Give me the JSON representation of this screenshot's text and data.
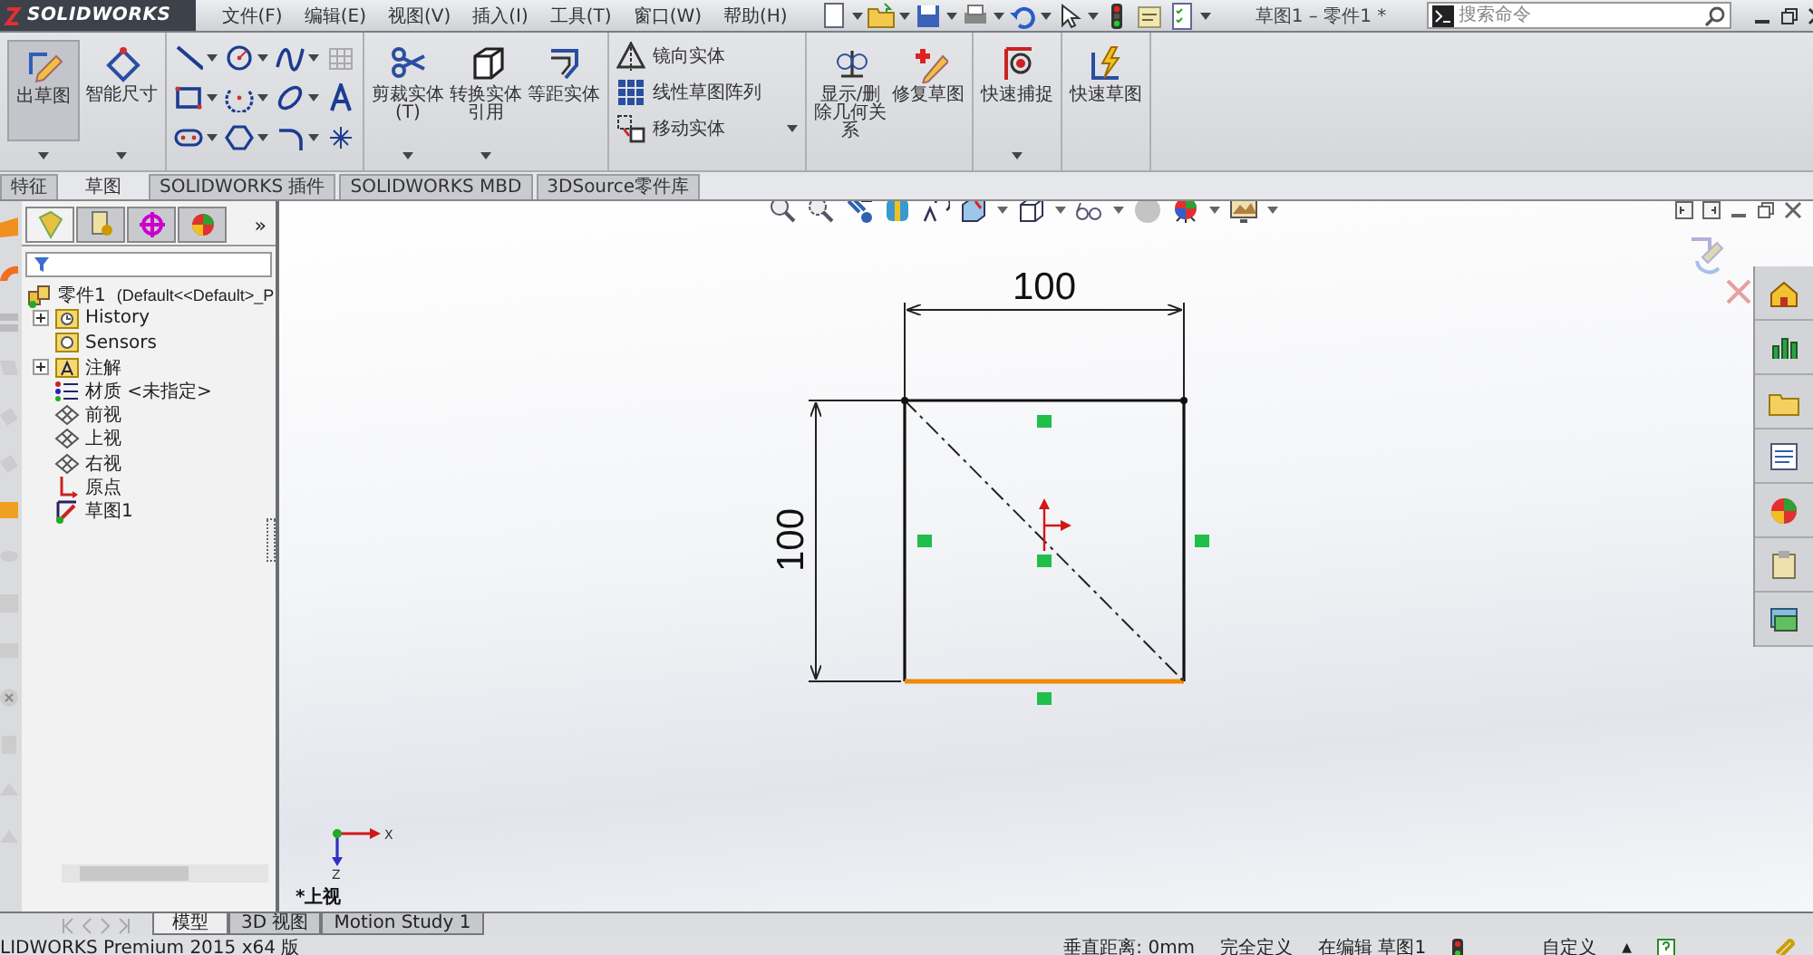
{
  "title_bar": {
    "logo": "SOLIDWORKS",
    "menus": [
      "文件(F)",
      "编辑(E)",
      "视图(V)",
      "插入(I)",
      "工具(T)",
      "窗口(W)",
      "帮助(H)"
    ],
    "document_title": "草图1 – 零件1 *",
    "search": {
      "placeholder": "搜索命令"
    }
  },
  "ribbon": {
    "groups": [
      {
        "kind": "large",
        "items": [
          {
            "label": "出草图",
            "pressed": true
          },
          {
            "label": "智能尺寸",
            "pressed": false
          }
        ]
      },
      {
        "kind": "tools"
      },
      {
        "kind": "large",
        "items": [
          {
            "label": "剪裁实体(T)",
            "pressed": false
          },
          {
            "label": "转换实体引用",
            "pressed": false
          },
          {
            "label": "等距实体",
            "pressed": false
          }
        ]
      },
      {
        "kind": "list",
        "items": [
          {
            "label": "镜向实体"
          },
          {
            "label": "线性草图阵列"
          },
          {
            "label": "移动实体"
          }
        ]
      },
      {
        "kind": "large",
        "items": [
          {
            "label": "显示/删除几何关系",
            "pressed": false
          },
          {
            "label": "修复草图",
            "pressed": false
          }
        ]
      },
      {
        "kind": "large",
        "items": [
          {
            "label": "快速捕捉",
            "pressed": false
          }
        ]
      },
      {
        "kind": "large",
        "items": [
          {
            "label": "快速草图",
            "pressed": false
          }
        ]
      }
    ]
  },
  "command_tabs": [
    {
      "label": "特征",
      "selected": false
    },
    {
      "label": "草图",
      "selected": true
    },
    {
      "label": "SOLIDWORKS 插件",
      "selected": false
    },
    {
      "label": "SOLIDWORKS MBD",
      "selected": false
    },
    {
      "label": "3DSource零件库",
      "selected": false
    }
  ],
  "feature_manager": {
    "tabs": [
      {
        "selected": true
      },
      {
        "selected": false
      },
      {
        "selected": false
      },
      {
        "selected": false
      }
    ],
    "more": "»",
    "root": {
      "label": "零件1",
      "config": "(Default<<Default>_P",
      "children": [
        {
          "label": "History",
          "expander": true
        },
        {
          "label": "Sensors",
          "expander": false
        },
        {
          "label": "注解",
          "expander": true
        },
        {
          "label": "材质 <未指定>",
          "expander": false
        },
        {
          "label": "前视",
          "expander": false
        },
        {
          "label": "上视",
          "expander": false
        },
        {
          "label": "右视",
          "expander": false
        },
        {
          "label": "原点",
          "expander": false
        },
        {
          "label": "草图1",
          "expander": false
        }
      ]
    }
  },
  "graphics_area": {
    "dimensions": {
      "horizontal": "100",
      "vertical": "100"
    },
    "triad": {
      "x_label": "X",
      "z_label": "Z"
    },
    "view_label": "*上视"
  },
  "bottom_tabs": [
    {
      "label": "模型",
      "selected": true
    },
    {
      "label": "3D 视图",
      "selected": false
    },
    {
      "label": "Motion Study 1",
      "selected": false
    }
  ],
  "status_bar": {
    "product": "LIDWORKS Premium 2015 x64 版",
    "distance": "垂直距离: 0mm",
    "definition": "完全定义",
    "editing": "在编辑 草图1",
    "units": "自定义",
    "caret": "▲"
  }
}
